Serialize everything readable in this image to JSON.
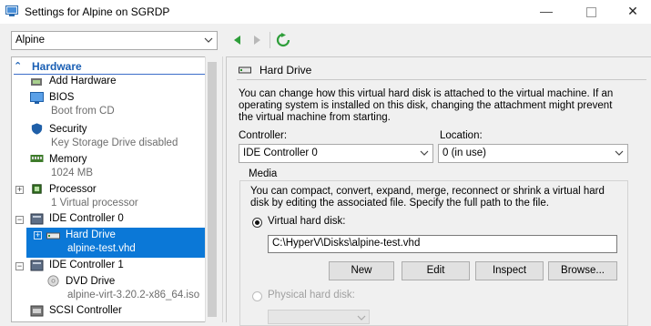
{
  "window": {
    "title": "Settings for Alpine on SGRDP",
    "minimize": "—",
    "close": "✕"
  },
  "vm_selector": {
    "value": "Alpine"
  },
  "tree": {
    "section": "Hardware",
    "items": [
      {
        "label": "Add Hardware",
        "sub": ""
      },
      {
        "label": "BIOS",
        "sub": "Boot from CD"
      },
      {
        "label": "Security",
        "sub": "Key Storage Drive disabled"
      },
      {
        "label": "Memory",
        "sub": "1024 MB"
      },
      {
        "label": "Processor",
        "sub": "1 Virtual processor"
      },
      {
        "label": "IDE Controller 0",
        "sub": ""
      },
      {
        "label": "Hard Drive",
        "sub": "alpine-test.vhd"
      },
      {
        "label": "IDE Controller 1",
        "sub": ""
      },
      {
        "label": "DVD Drive",
        "sub": "alpine-virt-3.20.2-x86_64.iso"
      },
      {
        "label": "SCSI Controller",
        "sub": ""
      }
    ]
  },
  "panel": {
    "title": "Hard Drive",
    "description": "You can change how this virtual hard disk is attached to the virtual machine. If an operating system is installed on this disk, changing the attachment might prevent the virtual machine from starting.",
    "controller_label": "Controller:",
    "controller_value": "IDE Controller 0",
    "location_label": "Location:",
    "location_value": "0 (in use)",
    "media_label": "Media",
    "media_description": "You can compact, convert, expand, merge, reconnect or shrink a virtual hard disk by editing the associated file. Specify the full path to the file.",
    "vhd_label": "Virtual hard disk:",
    "vhd_path": "C:\\HyperV\\Disks\\alpine-test.vhd",
    "buttons": {
      "new": "New",
      "edit": "Edit",
      "inspect": "Inspect",
      "browse": "Browse..."
    },
    "physical_label": "Physical hard disk:"
  },
  "colors": {
    "accent": "#0b78d7",
    "header": "#1a5fb4",
    "nav_green": "#2e9e3a"
  }
}
